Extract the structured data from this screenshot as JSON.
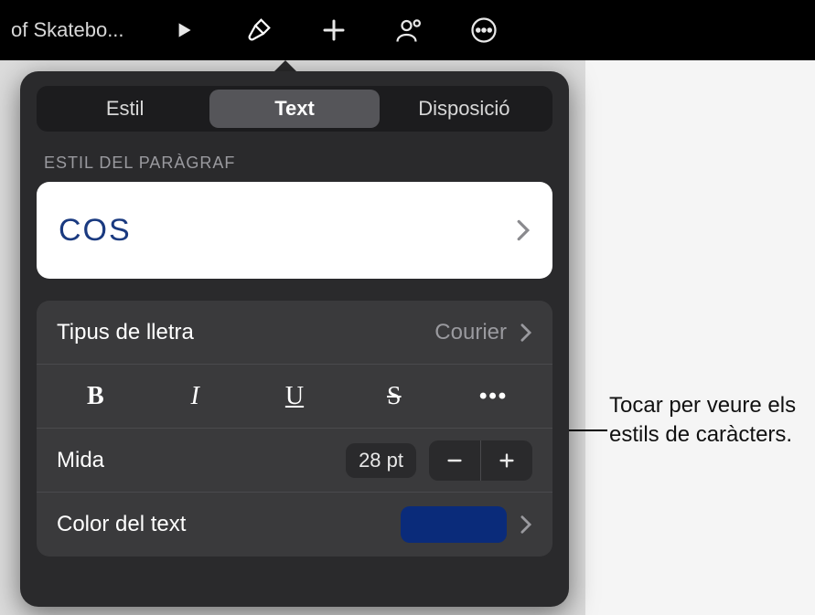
{
  "toolbar": {
    "title": "of Skatebo..."
  },
  "tabs": {
    "style": "Estil",
    "text": "Text",
    "layout": "Disposició",
    "selected": "text"
  },
  "paragraph": {
    "section_label": "ESTIL DEL PARÀGRAF",
    "style_name": "COS"
  },
  "font": {
    "label": "Tipus de lletra",
    "value": "Courier"
  },
  "size": {
    "label": "Mida",
    "value": "28 pt"
  },
  "text_color": {
    "label": "Color del text",
    "value": "#0a2b7a"
  },
  "callout": {
    "text": "Tocar per veure els estils de caràcters."
  }
}
